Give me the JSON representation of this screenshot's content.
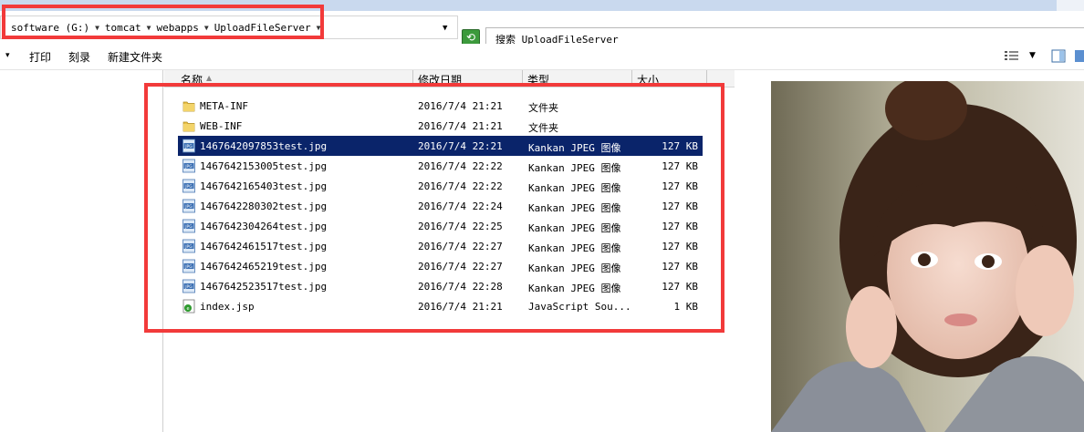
{
  "addressbar": {
    "crumbs": [
      "software (G:)",
      "tomcat",
      "webapps",
      "UploadFileServer"
    ],
    "search_text": "搜索 UploadFileServer"
  },
  "toolbar": {
    "organize_arrow": "▾",
    "print": "打印",
    "burn": "刻录",
    "new_folder": "新建文件夹"
  },
  "columns": {
    "name": "名称",
    "date": "修改日期",
    "type": "类型",
    "size": "大小"
  },
  "files": [
    {
      "name": "META-INF",
      "date": "2016/7/4 21:21",
      "type": "文件夹",
      "size": "",
      "icon": "folder-icon"
    },
    {
      "name": "WEB-INF",
      "date": "2016/7/4 21:21",
      "type": "文件夹",
      "size": "",
      "icon": "folder-icon"
    },
    {
      "name": "1467642097853test.jpg",
      "date": "2016/7/4 22:21",
      "type": "Kankan JPEG 图像",
      "size": "127 KB",
      "icon": "jpeg-file-icon",
      "selected": true
    },
    {
      "name": "1467642153005test.jpg",
      "date": "2016/7/4 22:22",
      "type": "Kankan JPEG 图像",
      "size": "127 KB",
      "icon": "jpeg-file-icon"
    },
    {
      "name": "1467642165403test.jpg",
      "date": "2016/7/4 22:22",
      "type": "Kankan JPEG 图像",
      "size": "127 KB",
      "icon": "jpeg-file-icon"
    },
    {
      "name": "1467642280302test.jpg",
      "date": "2016/7/4 22:24",
      "type": "Kankan JPEG 图像",
      "size": "127 KB",
      "icon": "jpeg-file-icon"
    },
    {
      "name": "1467642304264test.jpg",
      "date": "2016/7/4 22:25",
      "type": "Kankan JPEG 图像",
      "size": "127 KB",
      "icon": "jpeg-file-icon"
    },
    {
      "name": "1467642461517test.jpg",
      "date": "2016/7/4 22:27",
      "type": "Kankan JPEG 图像",
      "size": "127 KB",
      "icon": "jpeg-file-icon"
    },
    {
      "name": "1467642465219test.jpg",
      "date": "2016/7/4 22:27",
      "type": "Kankan JPEG 图像",
      "size": "127 KB",
      "icon": "jpeg-file-icon"
    },
    {
      "name": "1467642523517test.jpg",
      "date": "2016/7/4 22:28",
      "type": "Kankan JPEG 图像",
      "size": "127 KB",
      "icon": "jpeg-file-icon"
    },
    {
      "name": "index.jsp",
      "date": "2016/7/4 21:21",
      "type": "JavaScript Sou...",
      "size": "1 KB",
      "icon": "javascript-file-icon"
    }
  ],
  "colors": {
    "selection": "#0a246a",
    "highlight_box": "#f23a3a"
  }
}
